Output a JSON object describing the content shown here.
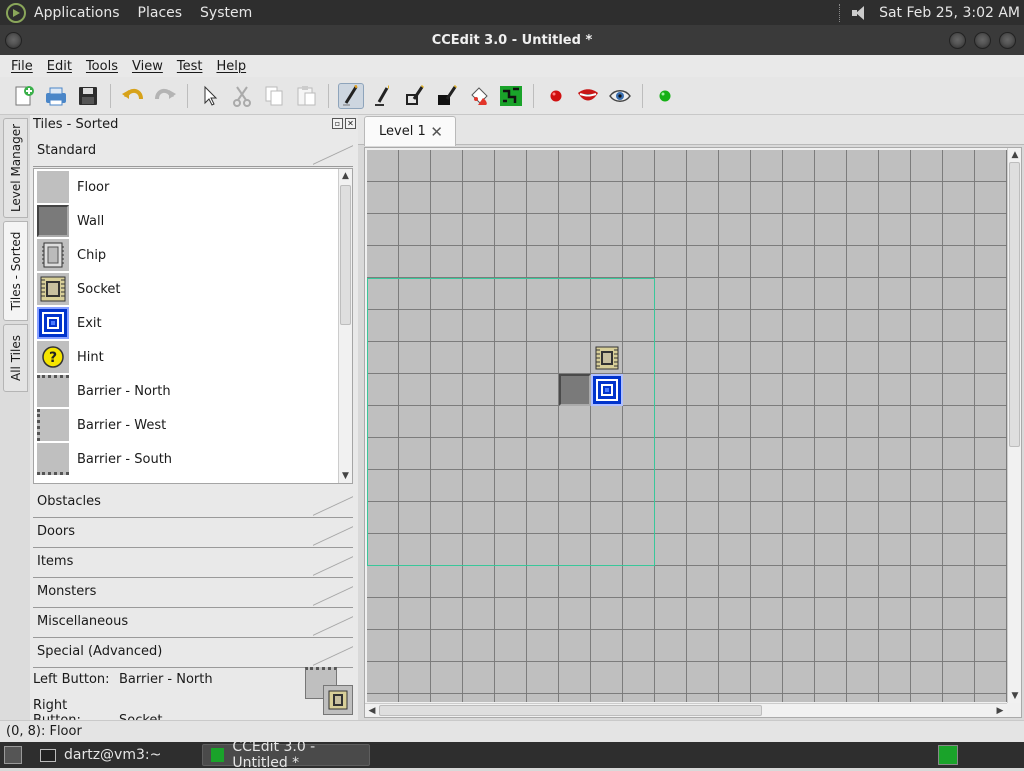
{
  "top_panel": {
    "menus": [
      "Applications",
      "Places",
      "System"
    ],
    "clock": "Sat Feb 25,  3:02 AM"
  },
  "window": {
    "title": "CCEdit 3.0 - Untitled *"
  },
  "menubar": {
    "items": [
      "File",
      "Edit",
      "Tools",
      "View",
      "Test",
      "Help"
    ]
  },
  "toolbar": {
    "buttons": [
      "new-level",
      "open",
      "save",
      "undo",
      "redo",
      "select",
      "cut",
      "copy",
      "paste",
      "draw",
      "pencil",
      "line",
      "fill",
      "flood",
      "trap-connect",
      "record",
      "lips",
      "view",
      "test"
    ]
  },
  "vertical_tabs": [
    "Level Manager",
    "Tiles - Sorted",
    "All Tiles"
  ],
  "dock": {
    "title": "Tiles - Sorted",
    "sections": [
      "Standard",
      "Obstacles",
      "Doors",
      "Items",
      "Monsters",
      "Miscellaneous",
      "Special (Advanced)"
    ],
    "tiles": [
      "Floor",
      "Wall",
      "Chip",
      "Socket",
      "Exit",
      "Hint",
      "Barrier - North",
      "Barrier - West",
      "Barrier - South"
    ],
    "left_button_label": "Left Button:",
    "left_button_value": "Barrier - North",
    "right_button_label": "Right Button:",
    "right_button_value": "Socket"
  },
  "editor": {
    "tab_label": "Level 1"
  },
  "status": "(0, 8): Floor",
  "taskbar": {
    "items": [
      "dartz@vm3:~",
      "CCEdit 3.0 - Untitled *"
    ]
  },
  "colors": {
    "selection": "#39c79a",
    "exit_blue": "#0033cc",
    "floor": "#bfbfbf",
    "wall": "#7a7a7a"
  }
}
